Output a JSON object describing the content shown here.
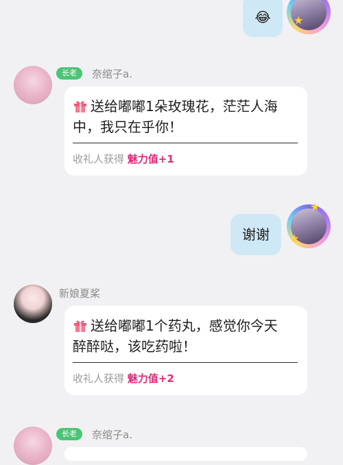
{
  "top_message": {
    "emoji": "😂"
  },
  "messages": [
    {
      "badge": "长老",
      "nickname": "奈绾子a.",
      "gift_line1": "送给嘟嘟1朵玫瑰花，茫茫人海",
      "gift_line2": "中，我只在乎你！",
      "receiver_prefix": "收礼人获得",
      "receiver_charm": "魅力值+1"
    },
    {
      "nickname": "新娘夏桨",
      "gift_line1": "送给嘟嘟1个药丸，感觉你今天",
      "gift_line2": "醉醉哒，该吃药啦！",
      "receiver_prefix": "收礼人获得",
      "receiver_charm": "魅力值+2"
    },
    {
      "badge": "长老",
      "nickname": "奈绾子a."
    }
  ],
  "my_reply": {
    "text": "谢谢"
  },
  "colors": {
    "background": "#f1f1f3",
    "badge_green": "#4cc476",
    "charm_pink": "#e0297a",
    "my_bubble": "#cfe8f6"
  }
}
